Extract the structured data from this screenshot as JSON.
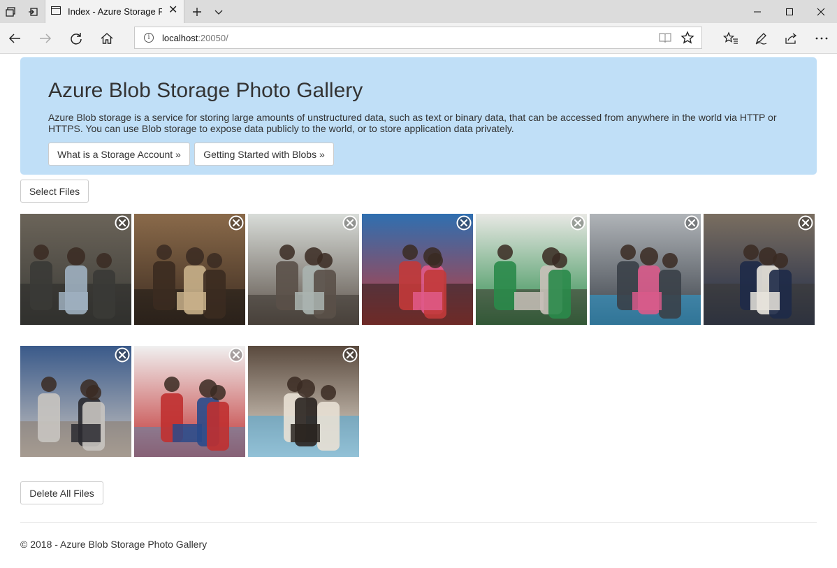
{
  "browser": {
    "tab_title": "Index - Azure Storage P",
    "url_host": "localhost",
    "url_rest": ":20050/"
  },
  "jumbotron": {
    "title": "Azure Blob Storage Photo Gallery",
    "description": "Azure Blob storage is a service for storing large amounts of unstructured data, such as text or binary data, that can be accessed from anywhere in the world via HTTP or HTTPS. You can use Blob storage to expose data publicly to the world, or to store application data privately.",
    "btn_storage_account": "What is a Storage Account »",
    "btn_getting_started": "Getting Started with Blobs »"
  },
  "actions": {
    "select_files": "Select Files",
    "delete_all": "Delete All Files"
  },
  "gallery": {
    "photos": [
      {
        "scene": "modern building interior with people standing",
        "palette": [
          "#6b6459",
          "#3a3a36",
          "#9fb0c0",
          "#2a2a28"
        ]
      },
      {
        "scene": "people working at cafe table with laptops",
        "palette": [
          "#8a6a4a",
          "#3b2b20",
          "#c8b08a",
          "#1e1a16"
        ]
      },
      {
        "scene": "presentation in a conference room",
        "palette": [
          "#d8dcd8",
          "#5a5048",
          "#aab4b0",
          "#3a3430"
        ]
      },
      {
        "scene": "children looking at a tablet",
        "palette": [
          "#2f6fb0",
          "#c23a3a",
          "#e05a8a",
          "#2a1e18"
        ]
      },
      {
        "scene": "two women talking with a laptop",
        "palette": [
          "#e8e8e4",
          "#2a8a4a",
          "#c8c0b8",
          "#3a3028"
        ]
      },
      {
        "scene": "overhead view of team around a table",
        "palette": [
          "#b0b4b8",
          "#3a4048",
          "#d85a8a",
          "#2aa0d8"
        ]
      },
      {
        "scene": "man and woman discussing at a laptop",
        "palette": [
          "#7a6e60",
          "#1e2a48",
          "#e8e4dc",
          "#3a3834"
        ]
      },
      {
        "scene": "students collaborating in a classroom",
        "palette": [
          "#3a5a8a",
          "#c8c4c0",
          "#2a2a30",
          "#8a7a6a"
        ]
      },
      {
        "scene": "boy using a tablet in class",
        "palette": [
          "#f0f0f0",
          "#c03030",
          "#2a4a8a",
          "#5a8ab0"
        ]
      },
      {
        "scene": "people at a table with cups and a tablet",
        "palette": [
          "#5a4a3e",
          "#e8e0d4",
          "#2a2420",
          "#4aa8d8"
        ]
      }
    ]
  },
  "footer": {
    "copyright": "© 2018 - Azure Blob Storage Photo Gallery"
  },
  "colors": {
    "jumbotron_bg": "#c0dff7",
    "chrome_bg": "#f2f2f2",
    "titlebar_bg": "#dcdcdc"
  }
}
